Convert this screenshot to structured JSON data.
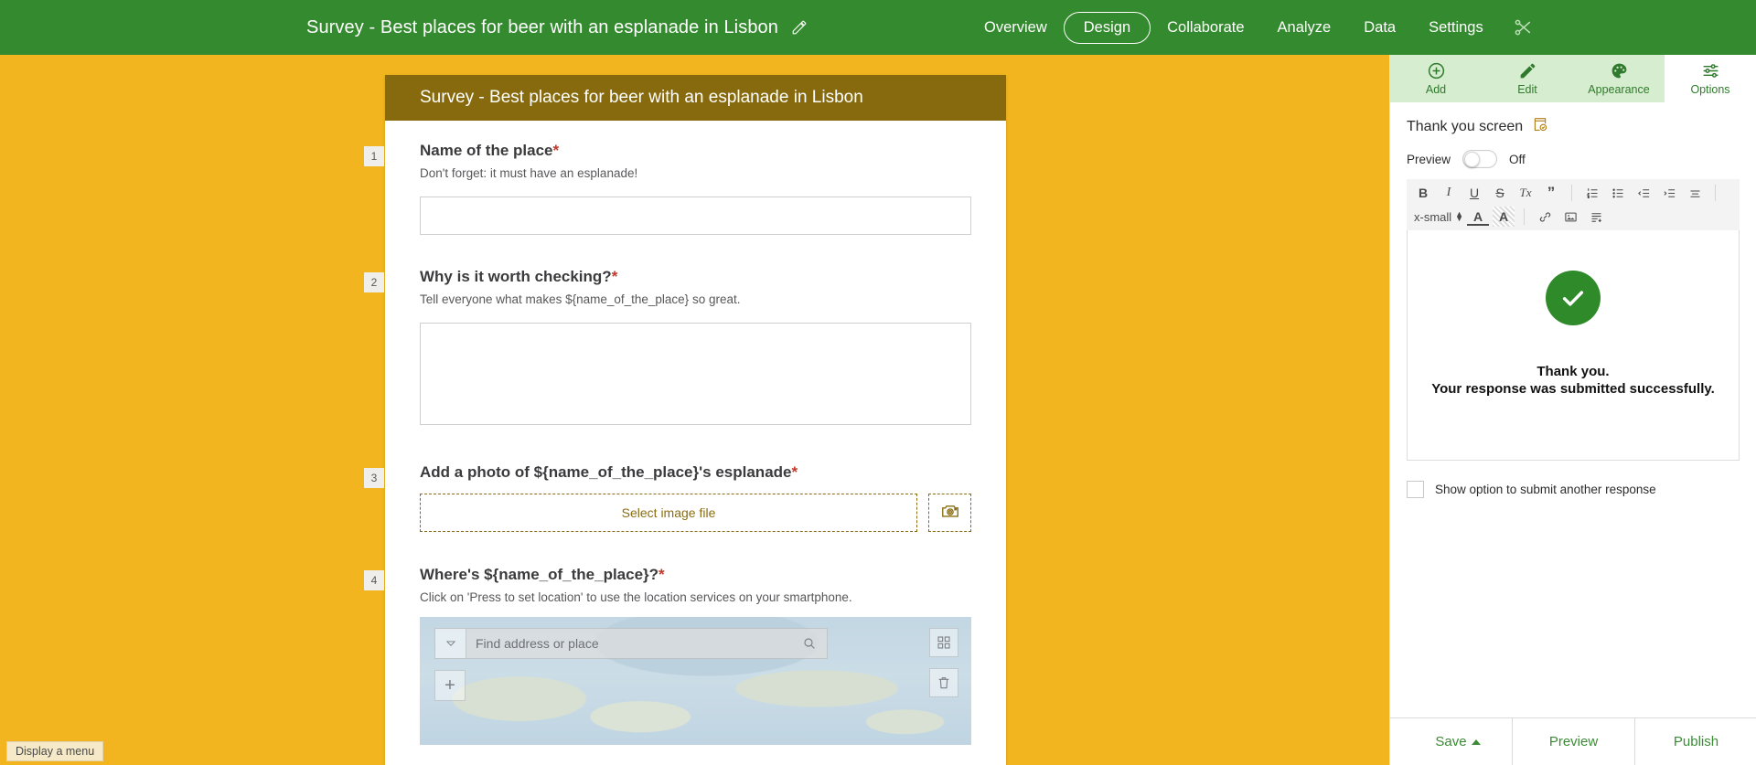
{
  "topnav": {
    "title": "Survey - Best places for beer with an esplanade in Lisbon",
    "edit_title_icon": "pencil-icon",
    "links": [
      {
        "label": "Overview",
        "active": false
      },
      {
        "label": "Design",
        "active": true
      },
      {
        "label": "Collaborate",
        "active": false
      },
      {
        "label": "Analyze",
        "active": false
      },
      {
        "label": "Data",
        "active": false
      },
      {
        "label": "Settings",
        "active": false
      }
    ],
    "tool_icon": "scissors-icon",
    "bg_color": "#348A2E"
  },
  "canvas": {
    "bg_color": "#F2B51F",
    "form": {
      "header_title": "Survey - Best places for beer with an esplanade in Lisbon",
      "header_color": "#876A0E",
      "questions": [
        {
          "number": "1",
          "label": "Name of the place",
          "required": "*",
          "hint": "Don't forget: it must have an esplanade!",
          "type": "text",
          "value": "",
          "placeholder": ""
        },
        {
          "number": "2",
          "label": "Why is it worth checking?",
          "required": "*",
          "hint": "Tell everyone what makes ${name_of_the_place} so great.",
          "type": "textarea",
          "value": "",
          "placeholder": ""
        },
        {
          "number": "3",
          "label": "Add a photo of ${name_of_the_place}'s esplanade",
          "required": "*",
          "hint": "",
          "type": "image",
          "drop_label": "Select image file",
          "camera_icon": "camera-icon"
        },
        {
          "number": "4",
          "label": "Where's ${name_of_the_place}?",
          "required": "*",
          "hint": "Click on 'Press to set location' to use the location services on your smartphone.",
          "type": "map",
          "search_placeholder": "Find address or place",
          "zoom_in_label": "+",
          "icons": [
            "chevron-down-icon",
            "search-icon",
            "fullscreen-icon",
            "trash-icon"
          ]
        }
      ]
    }
  },
  "right_panel": {
    "tabs": [
      {
        "label": "Add",
        "icon": "plus-circle-icon",
        "active": false
      },
      {
        "label": "Edit",
        "icon": "pencil-icon",
        "active": false
      },
      {
        "label": "Appearance",
        "icon": "palette-icon",
        "active": false
      },
      {
        "label": "Options",
        "icon": "sliders-icon",
        "active": true
      }
    ],
    "section_title": "Thank you screen",
    "section_icon": "page-check-icon",
    "preview": {
      "label": "Preview",
      "state_label": "Off",
      "enabled": false
    },
    "editor_toolbar": {
      "row1": [
        {
          "name": "bold-icon",
          "glyph": "B"
        },
        {
          "name": "italic-icon",
          "glyph": "I"
        },
        {
          "name": "underline-icon",
          "glyph": "U"
        },
        {
          "name": "strikethrough-icon",
          "glyph": "S"
        },
        {
          "name": "clear-format-icon",
          "glyph": "Tx"
        },
        {
          "name": "blockquote-icon",
          "glyph": "”"
        },
        {
          "name": "ordered-list-icon",
          "glyph": ""
        },
        {
          "name": "unordered-list-icon",
          "glyph": ""
        },
        {
          "name": "outdent-icon",
          "glyph": ""
        },
        {
          "name": "indent-icon",
          "glyph": ""
        },
        {
          "name": "align-icon",
          "glyph": ""
        }
      ],
      "font_size": "x-small",
      "row2": [
        {
          "name": "font-color-icon",
          "glyph": "A"
        },
        {
          "name": "highlight-color-icon",
          "glyph": "A"
        },
        {
          "name": "link-icon",
          "glyph": ""
        },
        {
          "name": "insert-image-icon",
          "glyph": ""
        },
        {
          "name": "insert-block-icon",
          "glyph": ""
        }
      ]
    },
    "thankyou": {
      "check_icon": "check-circle-icon",
      "line1": "Thank you.",
      "line2": "Your response was submitted successfully.",
      "accent_color": "#2F8A2A"
    },
    "submit_another": {
      "label": "Show option to submit another response",
      "checked": false
    },
    "footer": [
      {
        "label": "Save",
        "has_caret": true
      },
      {
        "label": "Preview",
        "has_caret": false
      },
      {
        "label": "Publish",
        "has_caret": false
      }
    ]
  },
  "tooltip": {
    "text": "Display a menu"
  }
}
